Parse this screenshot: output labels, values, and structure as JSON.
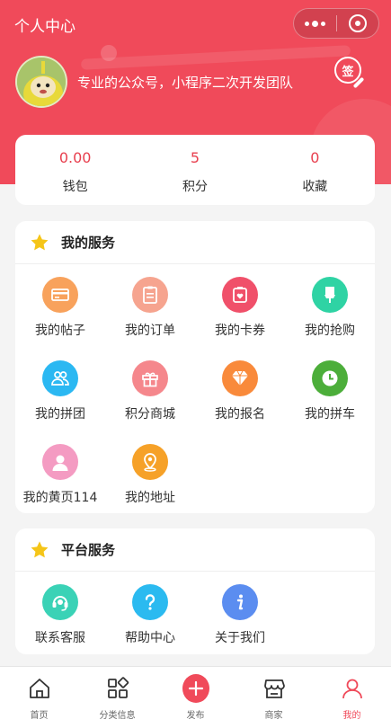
{
  "header": {
    "title": "个人中心",
    "slogan": "专业的公众号，小程序二次开发团队",
    "signin_label": "签"
  },
  "stats": [
    {
      "value": "0.00",
      "label": "钱包"
    },
    {
      "value": "5",
      "label": "积分"
    },
    {
      "value": "0",
      "label": "收藏"
    }
  ],
  "my_services": {
    "title": "我的服务",
    "items": [
      {
        "label": "我的帖子",
        "icon": "card-icon",
        "color": "#f8a25c"
      },
      {
        "label": "我的订单",
        "icon": "clipboard-icon",
        "color": "#f6a48f"
      },
      {
        "label": "我的卡券",
        "icon": "coupon-icon",
        "color": "#f0506a"
      },
      {
        "label": "我的抢购",
        "icon": "flash-sale-icon",
        "color": "#2fd3a4"
      },
      {
        "label": "我的拼团",
        "icon": "group-icon",
        "color": "#2bb8f2"
      },
      {
        "label": "积分商城",
        "icon": "gift-icon",
        "color": "#f5878c"
      },
      {
        "label": "我的报名",
        "icon": "diamond-icon",
        "color": "#f98a3b"
      },
      {
        "label": "我的拼车",
        "icon": "clock-icon",
        "color": "#4cae3a"
      },
      {
        "label": "我的黄页114",
        "icon": "person-icon",
        "color": "#f49bc2"
      },
      {
        "label": "我的地址",
        "icon": "location-icon",
        "color": "#f6a128"
      }
    ]
  },
  "platform_services": {
    "title": "平台服务",
    "items": [
      {
        "label": "联系客服",
        "icon": "headset-icon",
        "color": "#3ad2b6"
      },
      {
        "label": "帮助中心",
        "icon": "question-icon",
        "color": "#2bbaf0"
      },
      {
        "label": "关于我们",
        "icon": "info-icon",
        "color": "#5b8df0"
      }
    ]
  },
  "tabbar": {
    "active_color": "#f04a5a",
    "items": [
      {
        "label": "首页",
        "icon": "home-icon"
      },
      {
        "label": "分类信息",
        "icon": "category-icon"
      },
      {
        "label": "发布",
        "icon": "plus-icon"
      },
      {
        "label": "商家",
        "icon": "shop-icon"
      },
      {
        "label": "我的",
        "icon": "user-icon"
      }
    ]
  }
}
